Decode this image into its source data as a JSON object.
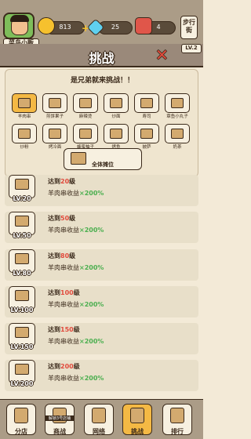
{
  "status": {
    "player_name": "菜鸟小贩",
    "coins": "813",
    "gems": "25",
    "likes": "4",
    "walk_street": "步行街",
    "level": "LV.2",
    "colors": {
      "accent": "#f4b944",
      "danger": "#e04a3c",
      "bonus": "#4caf50"
    }
  },
  "title": "挑战",
  "panel": {
    "heading": "是兄弟就来挑战！！",
    "items": [
      {
        "label": "羊肉串",
        "icon": "skewer-cart-icon",
        "selected": true
      },
      {
        "label": "煎饼果子",
        "icon": "pancake-cart-icon"
      },
      {
        "label": "麻辣烫",
        "icon": "spicy-pot-icon"
      },
      {
        "label": "炒面",
        "icon": "noodle-cart-icon"
      },
      {
        "label": "寿司",
        "icon": "sushi-cart-icon"
      },
      {
        "label": "章鱼小丸子",
        "icon": "takoyaki-cart-icon"
      },
      {
        "label": "炒粉",
        "icon": "fried-noodle-icon"
      },
      {
        "label": "烤冷面",
        "icon": "grilled-noodle-icon"
      },
      {
        "label": "蜂蜜柚子",
        "icon": "honey-pomelo-icon"
      },
      {
        "label": "烤鱼",
        "icon": "grilled-fish-icon"
      },
      {
        "label": "披萨",
        "icon": "pizza-cart-icon"
      },
      {
        "label": "奶茶",
        "icon": "milk-tea-icon"
      }
    ],
    "all_label": "全体摊位"
  },
  "challenges": [
    {
      "lv": "LV.20",
      "goal_prefix": "达到",
      "goal_num": "20",
      "goal_suffix": "级",
      "reward": "羊肉串收益",
      "mult": "×200%"
    },
    {
      "lv": "LV.50",
      "goal_prefix": "达到",
      "goal_num": "50",
      "goal_suffix": "级",
      "reward": "羊肉串收益",
      "mult": "×200%"
    },
    {
      "lv": "LV.80",
      "goal_prefix": "达到",
      "goal_num": "80",
      "goal_suffix": "级",
      "reward": "羊肉串收益",
      "mult": "×200%"
    },
    {
      "lv": "LV.100",
      "goal_prefix": "达到",
      "goal_num": "100",
      "goal_suffix": "级",
      "reward": "羊肉串收益",
      "mult": "×200%"
    },
    {
      "lv": "LV.150",
      "goal_prefix": "达到",
      "goal_num": "150",
      "goal_suffix": "级",
      "reward": "羊肉串收益",
      "mult": "×200%"
    },
    {
      "lv": "LV.200",
      "goal_prefix": "达到",
      "goal_num": "200",
      "goal_suffix": "级",
      "reward": "羊肉串收益",
      "mult": "×200%"
    }
  ],
  "nav": [
    {
      "label": "分店",
      "locked": false
    },
    {
      "label": "商战",
      "locked": true,
      "lock_text": "解锁3号店铺"
    },
    {
      "label": "网络",
      "locked": false
    },
    {
      "label": "挑战",
      "locked": false,
      "active": true
    },
    {
      "label": "排行",
      "locked": false
    }
  ]
}
